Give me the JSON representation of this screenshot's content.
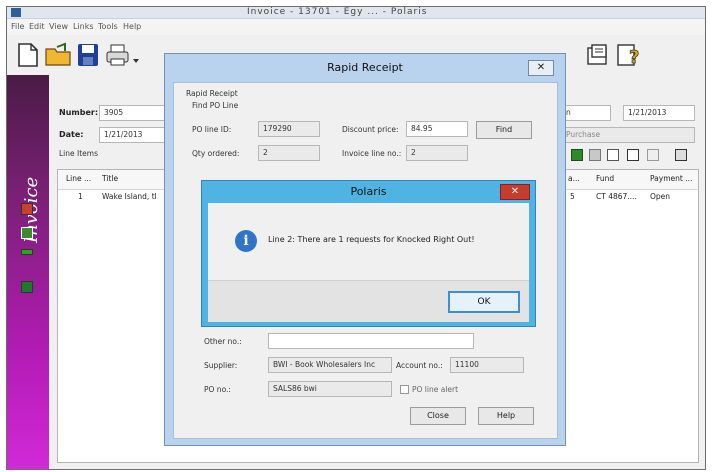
{
  "window": {
    "title": "Invoice - 13701 - Egy ... - Polaris"
  },
  "menu": [
    "File",
    "Edit",
    "View",
    "Links",
    "Tools",
    "Help"
  ],
  "sidebar": {
    "title": "Invoice"
  },
  "invoice": {
    "number_label": "Number:",
    "number_value": "3905",
    "date_label": "Date:",
    "date_value": "1/21/2013",
    "line_items_label": "Line Items",
    "right_date": "1/21/2013",
    "right_field_partial": "n",
    "purchase_placeholder": "Purchase"
  },
  "grid": {
    "columns": [
      "Line ...",
      "Title",
      "a...",
      "Fund",
      "Payment ..."
    ],
    "row": {
      "line": "1",
      "title": "Wake Island, tl",
      "a": "5",
      "fund": "CT 4867....",
      "payment": "Open"
    }
  },
  "rapid_receipt": {
    "title": "Rapid Receipt",
    "close": "✕",
    "section": "Rapid Receipt",
    "find_po_line": "Find PO Line",
    "po_line_id_label": "PO line ID:",
    "po_line_id": "179290",
    "discount_price_label": "Discount price:",
    "discount_price": "84.95",
    "find_button": "Find",
    "qty_ordered_label": "Qty ordered:",
    "qty_ordered": "2",
    "invoice_line_no_label": "Invoice line no.:",
    "invoice_line_no": "2",
    "other_no_label": "Other no.:",
    "supplier_label": "Supplier:",
    "supplier": "BWI - Book Wholesalers Inc",
    "account_no_label": "Account no.:",
    "account_no": "11100",
    "po_no_label": "PO no.:",
    "po_no": "SALS86 bwi",
    "po_line_alert": "PO line alert",
    "close_button": "Close",
    "help_button": "Help"
  },
  "polaris": {
    "title": "Polaris",
    "close": "✕",
    "message": "Line 2: There are 1 requests for Knocked Right Out!",
    "ok": "OK"
  }
}
